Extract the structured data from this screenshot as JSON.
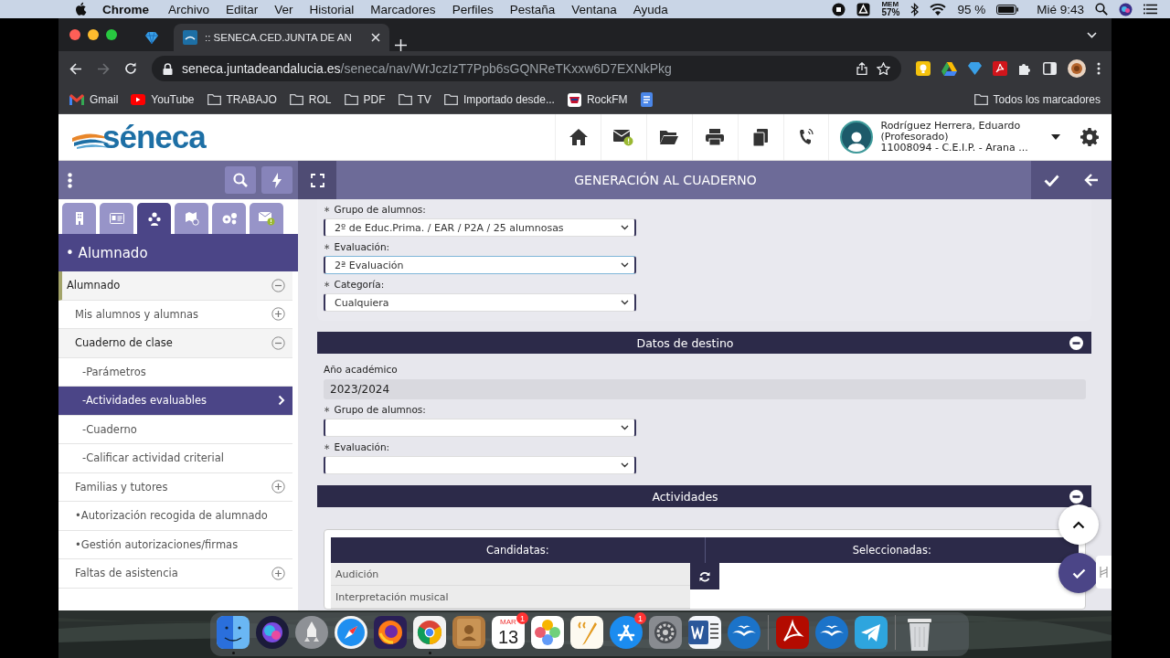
{
  "menu_bar": {
    "app_name": "Chrome",
    "menus": [
      "Archivo",
      "Editar",
      "Ver",
      "Historial",
      "Marcadores",
      "Perfiles",
      "Pestaña",
      "Ventana",
      "Ayuda"
    ],
    "memory_label": "MEM",
    "memory_value": "57%",
    "battery": "95 %",
    "clock": "Mié 9:43"
  },
  "browser": {
    "tab_title": ":: SENECA.CED.JUNTA DE AN",
    "url_host": "seneca.juntadeandalucia.es",
    "url_path": "/seneca/nav/WrJczIzT7Ppb6sGQNReTKxxw6D7EXNkPkg",
    "bookmarks": [
      {
        "kind": "gmail",
        "label": "Gmail"
      },
      {
        "kind": "youtube",
        "label": "YouTube"
      },
      {
        "kind": "folder",
        "label": "TRABAJO"
      },
      {
        "kind": "folder",
        "label": "ROL"
      },
      {
        "kind": "folder",
        "label": "PDF"
      },
      {
        "kind": "folder",
        "label": "TV"
      },
      {
        "kind": "folder",
        "label": "Importado desde..."
      },
      {
        "kind": "radio",
        "label": "RockFM"
      },
      {
        "kind": "docs"
      }
    ],
    "all_bookmarks": "Todos los marcadores"
  },
  "app": {
    "logo": "séneca",
    "user": {
      "name": "Rodríguez Herrera, Eduardo",
      "role": "(Profesorado)",
      "center": "11008094 - C.E.I.P. - Arana ..."
    },
    "page_title": "GENERACIÓN AL CUADERNO",
    "sidebar": {
      "tabs": [
        {
          "kind": "building",
          "selected": false
        },
        {
          "kind": "card",
          "selected": false
        },
        {
          "kind": "students",
          "selected": true
        },
        {
          "kind": "map",
          "selected": false
        },
        {
          "kind": "gears",
          "selected": false
        },
        {
          "kind": "mail",
          "selected": false
        }
      ],
      "section": "• Alumnado",
      "menu": [
        {
          "label": "Alumnado",
          "expanded": true,
          "selected": false,
          "children": [
            {
              "label": "Mis alumnos y alumnas",
              "expanded": false,
              "selected": false
            },
            {
              "label": "Cuaderno de clase",
              "expanded": true,
              "selected": false,
              "children": [
                {
                  "label": "-Parámetros",
                  "selected": false
                },
                {
                  "label": "-Actividades evaluables",
                  "selected": true
                },
                {
                  "label": "-Cuaderno",
                  "selected": false
                },
                {
                  "label": "-Calificar actividad criterial",
                  "selected": false
                }
              ]
            },
            {
              "label": "Familias y tutores",
              "expanded": false,
              "selected": false
            },
            {
              "label": "•Autorización recogida de alumnado",
              "selected": false
            },
            {
              "label": "•Gestión autorizaciones/firmas",
              "selected": false
            },
            {
              "label": "Faltas de asistencia",
              "expanded": false,
              "selected": false
            }
          ]
        }
      ]
    },
    "source_fields": [
      {
        "label": "Grupo de alumnos:",
        "required_mark": "∗",
        "value": "2º de Educ.Prima. / EAR / P2A / 25 alumnosas",
        "focused": false
      },
      {
        "label": "Evaluación:",
        "required_mark": "∗",
        "value": "2ª Evaluación",
        "focused": true
      },
      {
        "label": "Categoría:",
        "required_mark": "∗",
        "value": "Cualquiera",
        "focused": false
      }
    ],
    "destination": {
      "title": "Datos de destino",
      "expanded": true,
      "year_label": "Año académico",
      "year_value": "2023/2024",
      "fields": [
        {
          "label": "Grupo de alumnos:",
          "required_mark": "∗",
          "focused": false
        },
        {
          "label": "Evaluación:",
          "required_mark": "∗",
          "focused": false
        }
      ]
    },
    "activities": {
      "title": "Actividades",
      "expanded": true,
      "columns": [
        "Candidatas:",
        "Seleccionadas:"
      ],
      "candidates": [
        "Audición",
        "Interpretación musical"
      ]
    }
  },
  "dock": {
    "items": [
      {
        "kind": "finder",
        "running": true
      },
      {
        "kind": "siri",
        "running": false
      },
      {
        "kind": "launchpad",
        "running": false
      },
      {
        "kind": "safari",
        "running": false
      },
      {
        "kind": "firefox",
        "running": false
      },
      {
        "kind": "chrome",
        "running": true
      },
      {
        "kind": "contacts",
        "running": false
      },
      {
        "kind": "calendar",
        "running": false,
        "month": "MAR",
        "day": "13",
        "badge": "1"
      },
      {
        "kind": "photos",
        "running": false
      },
      {
        "kind": "pages",
        "running": false
      },
      {
        "kind": "appstore",
        "running": false,
        "badge": "1"
      },
      {
        "kind": "settings",
        "running": false
      },
      {
        "kind": "word",
        "running": false
      },
      {
        "kind": "gulls",
        "running": false
      },
      {
        "kind": "divider"
      },
      {
        "kind": "acrobat",
        "running": false
      },
      {
        "kind": "gulls",
        "running": false
      },
      {
        "kind": "telegram",
        "running": false
      },
      {
        "kind": "divider"
      },
      {
        "kind": "trash",
        "running": false
      }
    ]
  }
}
